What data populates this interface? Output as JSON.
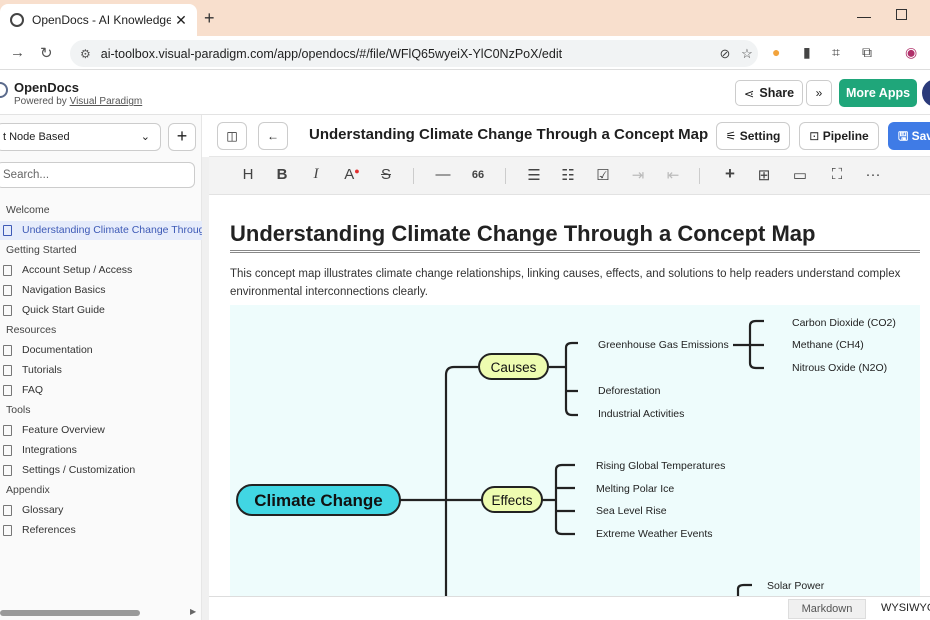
{
  "browser": {
    "tab_title": "OpenDocs - AI Knowledge Base",
    "url": "ai-toolbox.visual-paradigm.com/app/opendocs/#/file/WFlQ65wyeiX-YlC0NzPoX/edit"
  },
  "app": {
    "name": "OpenDocs",
    "powered_prefix": "Powered by ",
    "powered_link": "Visual Paradigm",
    "share_label": "Share",
    "more_apps_label": "More Apps"
  },
  "sidebar": {
    "mode": "t Node Based",
    "search_placeholder": "Search...",
    "items": [
      {
        "type": "section",
        "label": "Welcome"
      },
      {
        "type": "page",
        "label": "Understanding Climate Change Through",
        "active": true
      },
      {
        "type": "section",
        "label": "Getting Started"
      },
      {
        "type": "page",
        "label": "Account Setup / Access"
      },
      {
        "type": "page",
        "label": "Navigation Basics"
      },
      {
        "type": "page",
        "label": "Quick Start Guide"
      },
      {
        "type": "section",
        "label": "Resources"
      },
      {
        "type": "page",
        "label": "Documentation"
      },
      {
        "type": "page",
        "label": "Tutorials"
      },
      {
        "type": "page",
        "label": "FAQ"
      },
      {
        "type": "section",
        "label": "Tools"
      },
      {
        "type": "page",
        "label": "Feature Overview"
      },
      {
        "type": "page",
        "label": "Integrations"
      },
      {
        "type": "page",
        "label": "Settings / Customization"
      },
      {
        "type": "section",
        "label": "Appendix"
      },
      {
        "type": "page",
        "label": "Glossary"
      },
      {
        "type": "page",
        "label": "References"
      }
    ]
  },
  "doc": {
    "title": "Understanding Climate Change Through a Concept Map",
    "setting_label": "Setting",
    "pipeline_label": "Pipeline",
    "save_label": "Sav",
    "heading": "Understanding Climate Change Through a Concept Map",
    "intro": "This concept map illustrates climate change relationships, linking causes, effects, and solutions to help readers understand complex environmental interconnections clearly."
  },
  "toolbar": {
    "heading_glyph": "H",
    "bold_glyph": "B",
    "italic_glyph": "I",
    "color_glyph": "A",
    "strike_glyph": "S",
    "quote_glyph": "66",
    "more_glyph": "···"
  },
  "mindmap": {
    "root": "Climate Change",
    "causes": {
      "label": "Causes",
      "children": [
        "Greenhouse Gas Emissions",
        "Deforestation",
        "Industrial Activities"
      ],
      "gases": [
        "Carbon Dioxide (CO2)",
        "Methane (CH4)",
        "Nitrous Oxide (N2O)"
      ]
    },
    "effects": {
      "label": "Effects",
      "children": [
        "Rising Global Temperatures",
        "Melting Polar Ice",
        "Sea Level Rise",
        "Extreme Weather Events"
      ]
    },
    "solutions_partial": [
      "Solar Power"
    ],
    "colors": {
      "root": "#41d6e3",
      "branch": "#eefcb0",
      "background": "#eefcfc"
    }
  },
  "status": {
    "markdown_tab": "Markdown",
    "wysiwyg_tab": "WYSIWYG"
  }
}
